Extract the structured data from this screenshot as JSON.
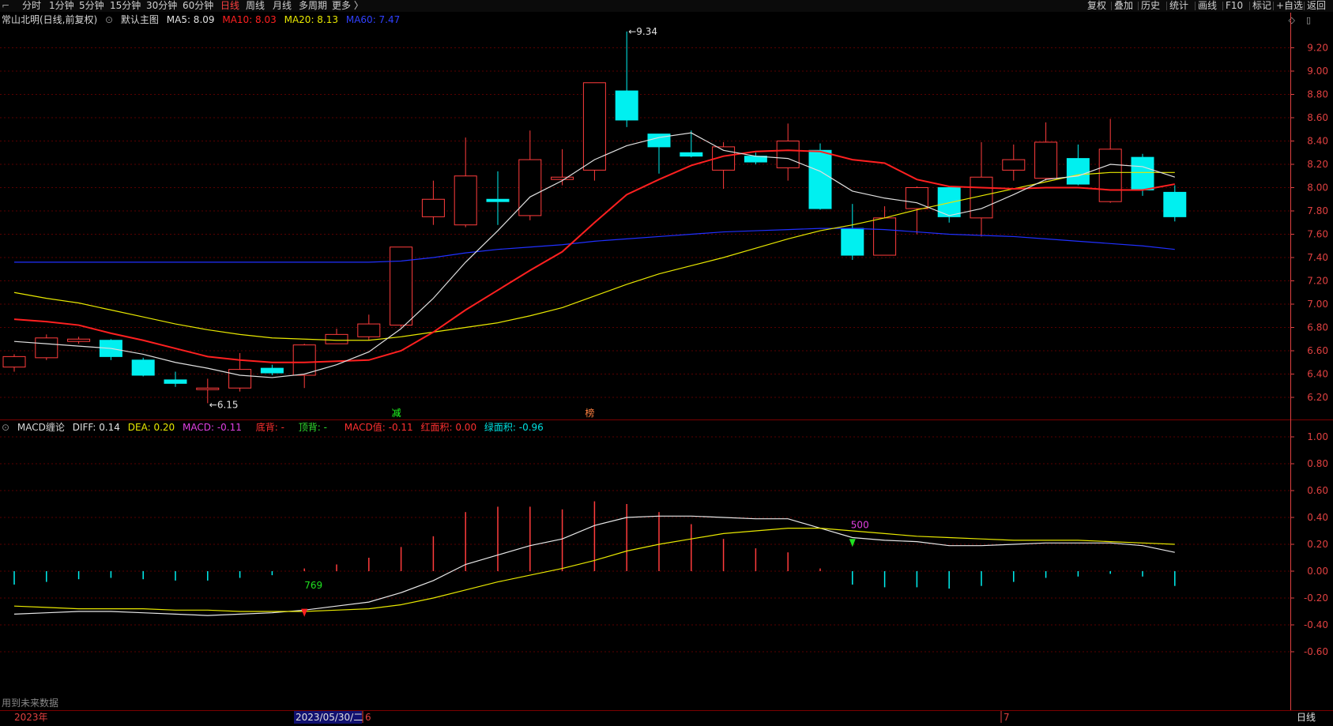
{
  "toolbar": {
    "menu_icon": "menu-corner-icon",
    "left_tabs": [
      "分时",
      "1分钟",
      "5分钟",
      "15分钟",
      "30分钟",
      "60分钟",
      "日线",
      "周线",
      "月线",
      "多周期",
      "更多 〉"
    ],
    "active_tab": "日线",
    "right_tabs": [
      "复权",
      "叠加",
      "历史",
      "统计",
      "画线",
      "F10",
      "标记",
      "+自选",
      "返回"
    ]
  },
  "main_legend": {
    "stock": "常山北明(日线,前复权)",
    "template": "默认主图",
    "ma5": "MA5: 8.09",
    "ma10": "MA10: 8.03",
    "ma20": "MA20: 8.13",
    "ma60": "MA60: 7.47"
  },
  "macd_legend": {
    "name": "MACD缠论",
    "diff": "DIFF: 0.14",
    "dea": "DEA: 0.20",
    "macd": "MACD: -0.11",
    "bottom_div": "底背: -",
    "top_div": "顶背: -",
    "macd_val": "MACD值: -0.11",
    "red_area": "红面积: 0.00",
    "green_area": "绿面积: -0.96"
  },
  "colors": {
    "up": "#ff3c3c",
    "down": "#00f0f0",
    "ma5": "#e0e0e0",
    "ma10": "#ff2020",
    "ma20": "#e8e800",
    "ma60": "#2030ff",
    "grid": "#5a0000",
    "axis": "#e04040"
  },
  "price_axis": [
    "9.20",
    "9.00",
    "8.80",
    "8.60",
    "8.40",
    "8.20",
    "8.00",
    "7.80",
    "7.60",
    "7.40",
    "7.20",
    "7.00",
    "6.80",
    "6.60",
    "6.40",
    "6.20"
  ],
  "macd_axis": [
    "1.00",
    "0.80",
    "0.60",
    "0.40",
    "0.20",
    "0.00",
    "-0.20",
    "-0.40",
    "-0.60"
  ],
  "annotations": {
    "high": "9.34",
    "low": "6.15",
    "mark_jian": "减",
    "mark_bang": "榜",
    "macd_mark1": "769",
    "macd_mark2": "500"
  },
  "date_axis": {
    "year": "2023年",
    "cursor_date": "2023/05/30/二",
    "m6": "6",
    "m7": "7"
  },
  "footer_note": "用到未来数据",
  "bottom_right": "日线",
  "chart_data": {
    "type": "candlestick",
    "candles": [
      {
        "o": 6.46,
        "c": 6.55,
        "h": 6.57,
        "l": 6.42
      },
      {
        "o": 6.54,
        "c": 6.71,
        "h": 6.74,
        "l": 6.52
      },
      {
        "o": 6.68,
        "c": 6.7,
        "h": 6.72,
        "l": 6.66
      },
      {
        "o": 6.69,
        "c": 6.55,
        "h": 6.7,
        "l": 6.52
      },
      {
        "o": 6.52,
        "c": 6.39,
        "h": 6.54,
        "l": 6.38
      },
      {
        "o": 6.35,
        "c": 6.32,
        "h": 6.42,
        "l": 6.29
      },
      {
        "o": 6.28,
        "c": 6.28,
        "h": 6.36,
        "l": 6.15
      },
      {
        "o": 6.28,
        "c": 6.44,
        "h": 6.58,
        "l": 6.25
      },
      {
        "o": 6.45,
        "c": 6.41,
        "h": 6.48,
        "l": 6.39
      },
      {
        "o": 6.39,
        "c": 6.65,
        "h": 6.66,
        "l": 6.28
      },
      {
        "o": 6.66,
        "c": 6.74,
        "h": 6.79,
        "l": 6.66
      },
      {
        "o": 6.72,
        "c": 6.83,
        "h": 6.91,
        "l": 6.69
      },
      {
        "o": 6.82,
        "c": 7.49,
        "h": 7.49,
        "l": 6.8
      },
      {
        "o": 7.75,
        "c": 7.9,
        "h": 8.06,
        "l": 7.68
      },
      {
        "o": 7.68,
        "c": 8.1,
        "h": 8.43,
        "l": 7.66
      },
      {
        "o": 7.9,
        "c": 7.88,
        "h": 8.14,
        "l": 7.68
      },
      {
        "o": 7.76,
        "c": 8.24,
        "h": 8.49,
        "l": 7.72
      },
      {
        "o": 8.07,
        "c": 8.09,
        "h": 8.33,
        "l": 8.02
      },
      {
        "o": 8.15,
        "c": 8.9,
        "h": 8.9,
        "l": 8.06
      },
      {
        "o": 8.83,
        "c": 8.58,
        "h": 9.34,
        "l": 8.52
      },
      {
        "o": 8.46,
        "c": 8.35,
        "h": 8.46,
        "l": 8.12
      },
      {
        "o": 8.3,
        "c": 8.27,
        "h": 8.49,
        "l": 8.26
      },
      {
        "o": 8.15,
        "c": 8.35,
        "h": 8.39,
        "l": 7.99
      },
      {
        "o": 8.27,
        "c": 8.22,
        "h": 8.3,
        "l": 8.2
      },
      {
        "o": 8.17,
        "c": 8.4,
        "h": 8.55,
        "l": 8.06
      },
      {
        "o": 8.32,
        "c": 7.82,
        "h": 8.38,
        "l": 7.81
      },
      {
        "o": 7.65,
        "c": 7.42,
        "h": 7.86,
        "l": 7.38
      },
      {
        "o": 7.42,
        "c": 7.74,
        "h": 7.84,
        "l": 7.42
      },
      {
        "o": 7.82,
        "c": 8.0,
        "h": 8.01,
        "l": 7.6
      },
      {
        "o": 8.0,
        "c": 7.75,
        "h": 8.01,
        "l": 7.7
      },
      {
        "o": 7.74,
        "c": 8.09,
        "h": 8.39,
        "l": 7.58
      },
      {
        "o": 8.15,
        "c": 8.24,
        "h": 8.37,
        "l": 8.06
      },
      {
        "o": 8.08,
        "c": 8.39,
        "h": 8.56,
        "l": 8.06
      },
      {
        "o": 8.25,
        "c": 8.03,
        "h": 8.37,
        "l": 8.02
      },
      {
        "o": 7.88,
        "c": 8.33,
        "h": 8.59,
        "l": 7.87
      },
      {
        "o": 8.26,
        "c": 7.98,
        "h": 8.29,
        "l": 7.93
      },
      {
        "o": 7.96,
        "c": 7.75,
        "h": 8.02,
        "l": 7.71
      }
    ],
    "ma5": [
      6.68,
      6.66,
      6.64,
      6.62,
      6.57,
      6.5,
      6.45,
      6.39,
      6.37,
      6.4,
      6.48,
      6.59,
      6.79,
      7.05,
      7.36,
      7.63,
      7.92,
      8.06,
      8.24,
      8.36,
      8.43,
      8.47,
      8.32,
      8.27,
      8.25,
      8.14,
      7.97,
      7.91,
      7.87,
      7.76,
      7.82,
      7.94,
      8.07,
      8.1,
      8.2,
      8.18,
      8.09
    ],
    "ma10": [
      6.87,
      6.85,
      6.82,
      6.75,
      6.69,
      6.62,
      6.55,
      6.52,
      6.5,
      6.5,
      6.51,
      6.52,
      6.6,
      6.76,
      6.95,
      7.12,
      7.29,
      7.45,
      7.7,
      7.94,
      8.07,
      8.19,
      8.27,
      8.31,
      8.32,
      8.31,
      8.24,
      8.21,
      8.07,
      8.01,
      8.0,
      7.99,
      8.0,
      8.0,
      7.98,
      7.98,
      8.03
    ],
    "ma20": [
      7.1,
      7.05,
      7.01,
      6.95,
      6.89,
      6.83,
      6.78,
      6.74,
      6.71,
      6.7,
      6.69,
      6.69,
      6.72,
      6.76,
      6.8,
      6.84,
      6.9,
      6.97,
      7.07,
      7.17,
      7.26,
      7.33,
      7.4,
      7.48,
      7.56,
      7.63,
      7.68,
      7.74,
      7.81,
      7.87,
      7.93,
      7.99,
      8.05,
      8.11,
      8.13,
      8.13,
      8.13
    ],
    "ma60": [
      7.36,
      7.36,
      7.36,
      7.36,
      7.36,
      7.36,
      7.36,
      7.36,
      7.36,
      7.36,
      7.36,
      7.36,
      7.37,
      7.4,
      7.44,
      7.47,
      7.49,
      7.51,
      7.54,
      7.56,
      7.58,
      7.6,
      7.62,
      7.63,
      7.64,
      7.65,
      7.65,
      7.64,
      7.62,
      7.6,
      7.59,
      7.58,
      7.56,
      7.54,
      7.52,
      7.5,
      7.47
    ],
    "diff": [
      -0.32,
      -0.31,
      -0.3,
      -0.3,
      -0.31,
      -0.32,
      -0.33,
      -0.32,
      -0.31,
      -0.29,
      -0.26,
      -0.23,
      -0.16,
      -0.07,
      0.05,
      0.12,
      0.19,
      0.24,
      0.34,
      0.4,
      0.41,
      0.41,
      0.4,
      0.39,
      0.39,
      0.32,
      0.25,
      0.23,
      0.22,
      0.19,
      0.19,
      0.2,
      0.21,
      0.21,
      0.21,
      0.19,
      0.14
    ],
    "dea": [
      -0.26,
      -0.27,
      -0.28,
      -0.28,
      -0.28,
      -0.29,
      -0.29,
      -0.3,
      -0.3,
      -0.3,
      -0.29,
      -0.28,
      -0.25,
      -0.2,
      -0.14,
      -0.08,
      -0.03,
      0.02,
      0.08,
      0.15,
      0.2,
      0.24,
      0.28,
      0.3,
      0.32,
      0.32,
      0.3,
      0.28,
      0.26,
      0.25,
      0.24,
      0.23,
      0.23,
      0.23,
      0.22,
      0.21,
      0.2
    ],
    "macd_bars": [
      -0.1,
      -0.08,
      -0.06,
      -0.05,
      -0.06,
      -0.07,
      -0.07,
      -0.05,
      -0.03,
      0.02,
      0.05,
      0.1,
      0.18,
      0.26,
      0.44,
      0.48,
      0.48,
      0.46,
      0.52,
      0.5,
      0.44,
      0.35,
      0.24,
      0.17,
      0.14,
      0.02,
      -0.1,
      -0.12,
      -0.12,
      -0.13,
      -0.11,
      -0.08,
      -0.05,
      -0.04,
      -0.02,
      -0.04,
      -0.11
    ]
  }
}
